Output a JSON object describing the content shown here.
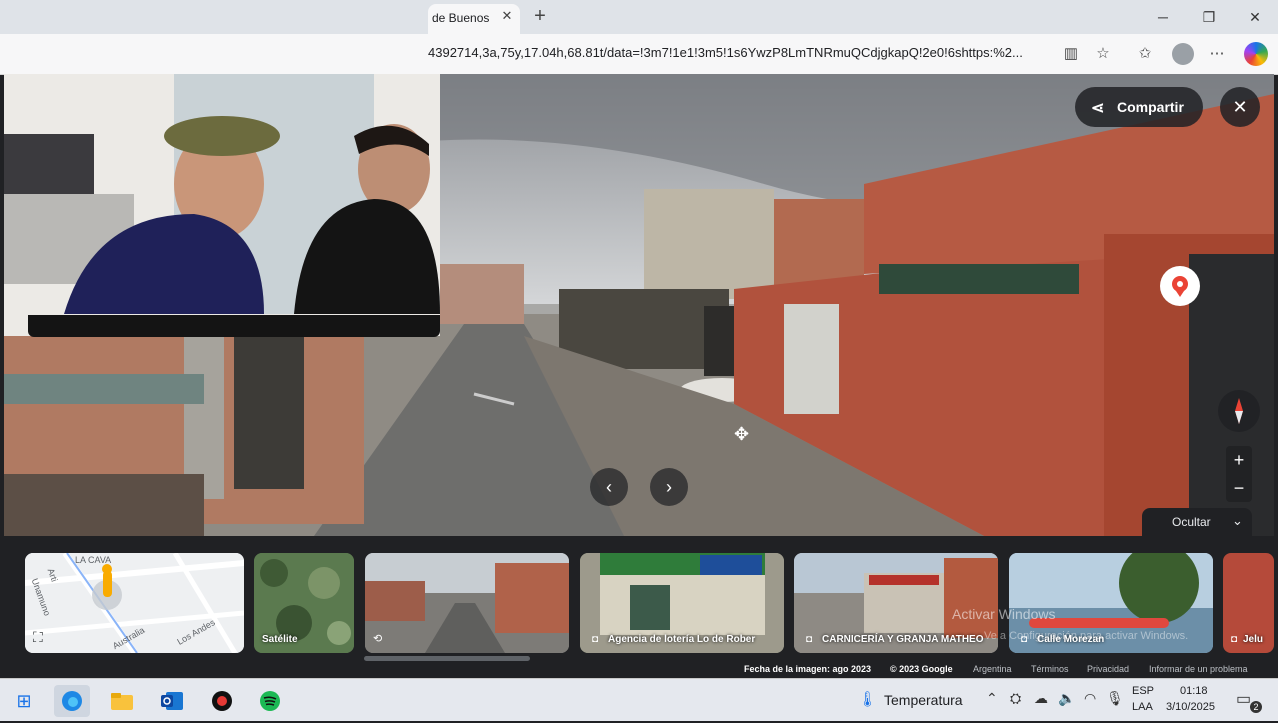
{
  "browser": {
    "tab_title": "de Buenos",
    "tab_close": "✕",
    "new_tab": "+",
    "url": "4392714,3a,75y,17.04h,68.81t/data=!3m7!1e1!3m5!1s6YwzP8LmTNRmuQCdjgkapQ!2e0!6shttps:%2..."
  },
  "streetview": {
    "share_label": "Compartir",
    "close": "✕",
    "zoom_in": "+",
    "zoom_out": "−",
    "prev": "‹",
    "next": "›",
    "hide_label": "Ocultar"
  },
  "filmstrip": {
    "map_labels": [
      "LA CAVA",
      "Unamuno",
      "Arti",
      "Australia",
      "Los Andes"
    ],
    "items": [
      {
        "label": "Satélite"
      },
      {
        "label": ""
      },
      {
        "label": "Agencia de lotería Lo de Rober"
      },
      {
        "label": "CARNICERÍA Y GRANJA MATHEO"
      },
      {
        "label": "Calle Morezan"
      },
      {
        "label": "Jelu"
      }
    ]
  },
  "footer": {
    "date": "Fecha de la imagen: ago 2023",
    "copyright": "© 2023 Google",
    "country": "Argentina",
    "terms": "Términos",
    "privacy": "Privacidad",
    "report": "Informar de un problema"
  },
  "overlay": {
    "activate": "Activar Windows",
    "activate_sub": "Ve a Configuración para activar Windows."
  },
  "taskbar": {
    "weather": "Temperatura",
    "lang_top": "ESP",
    "lang_bottom": "LAA",
    "time": "01:18",
    "date": "3/10/2025",
    "notifications": "2"
  }
}
